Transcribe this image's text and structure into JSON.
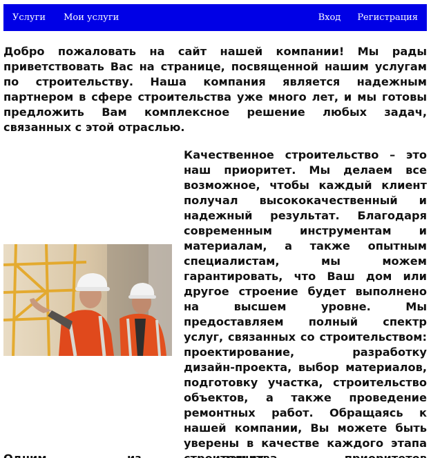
{
  "nav": {
    "left": [
      {
        "label": "Услуги"
      },
      {
        "label": "Мои услуги"
      }
    ],
    "right": [
      {
        "label": "Вход"
      },
      {
        "label": "Регистрация"
      }
    ]
  },
  "intro_text": "Добро пожаловать на сайт нашей компании! Мы рады приветствовать Вас на странице, посвященной нашим услугам по строительству. Наша компания является надежным партнером в сфере строительства уже много лет, и мы готовы предложить Вам комплексное решение любых задач, связанных с этой отраслью.",
  "photo": {
    "icon": "construction-workers-photo"
  },
  "side_text": "Качественное строительство – это наш приоритет. Мы делаем все возможное, чтобы каждый клиент получал высококачественный и надежный результат. Благодаря современным инструментам и материалам, а также опытным специалистам, мы можем гарантировать, что Ваш дом или другое строение будет выполнено на высшем уровне. Мы предоставляем полный спектр услуг, связанных со строительством: проектирование, разработку дизайн-проекта, выбор материалов, подготовку участка, строительство объектов, а также проведение ремонтных работ. Обращаясь к нашей компании, Вы можете быть уверены в качестве каждого этапа строительства.",
  "cutoff_text": "Одним из наших приоритетов",
  "colors": {
    "navbar": "#0000e6",
    "nav_text": "#ffffff",
    "body_text": "#111111"
  }
}
